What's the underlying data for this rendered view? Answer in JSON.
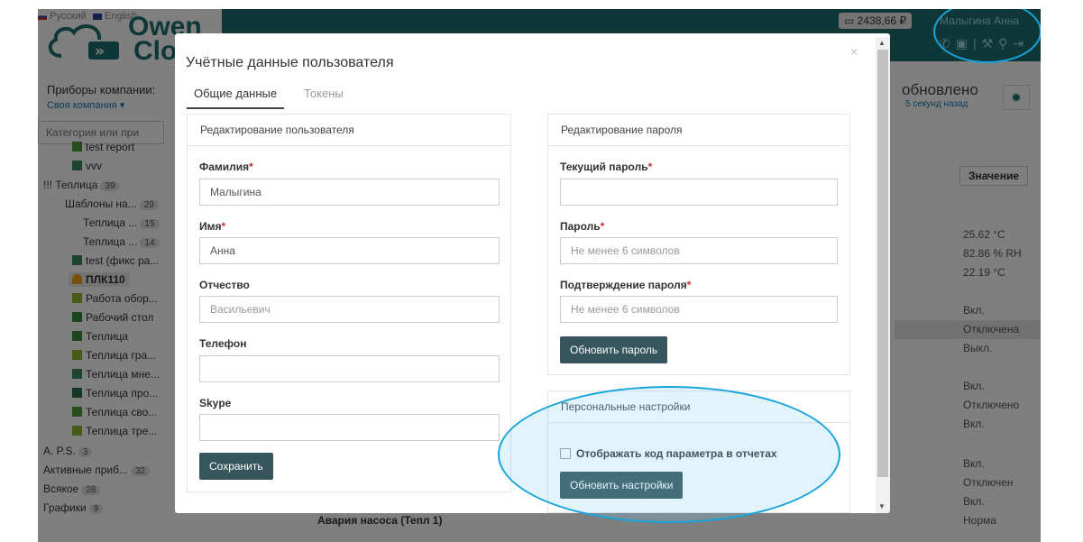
{
  "header": {
    "lang_ru": "Русский",
    "lang_en": "English",
    "logo_line1": "Owen",
    "logo_line2": "Clo",
    "balance": "2438,66 ₽",
    "user_name": "Малыгина Анна",
    "icons": [
      "phone-icon",
      "briefcase-icon",
      "wrench-icon",
      "user-icon",
      "logout-icon"
    ]
  },
  "left": {
    "title": "Приборы компании:",
    "company": "Своя компания ▾",
    "category_placeholder": "Категория или при",
    "tree": [
      {
        "label": "test report",
        "icon": "report-icon"
      },
      {
        "label": "vvv",
        "icon": "mnemo-icon"
      },
      {
        "label": "!!! Теплица",
        "badge": "39"
      },
      {
        "label": "Шаблоны на...",
        "badge": "29"
      },
      {
        "label": "Теплица ...",
        "badge": "15"
      },
      {
        "label": "Теплица ...",
        "badge": "14"
      },
      {
        "label": "test (фикс ра...",
        "icon": "mnemo-icon"
      },
      {
        "label": "ПЛК110",
        "icon": "bell-icon"
      },
      {
        "label": "Работа обор...",
        "icon": "chart-icon"
      },
      {
        "label": "Рабочий стол",
        "icon": "desktop-icon"
      },
      {
        "label": "Теплица",
        "icon": "desktop-icon"
      },
      {
        "label": "Теплица гра...",
        "icon": "chart-icon"
      },
      {
        "label": "Теплица мне...",
        "icon": "mnemo-icon"
      },
      {
        "label": "Теплица про...",
        "icon": "program-icon"
      },
      {
        "label": "Теплица сво...",
        "icon": "report-icon"
      },
      {
        "label": "Теплица тре...",
        "icon": "chart-icon"
      },
      {
        "label": "A. P.S.",
        "badge": "3"
      },
      {
        "label": "Активные приб...",
        "badge": "32"
      },
      {
        "label": "Всякое",
        "badge": "28"
      },
      {
        "label": "Графики",
        "badge": "9"
      }
    ]
  },
  "right": {
    "updated": "обновлено",
    "updated_sub": "5 секунд назад",
    "value_header": "Значение",
    "values": [
      "25.62 °C",
      "82.86 % RH",
      "22.19 °C",
      "Вкл.",
      "Отключена",
      "Выкл.",
      "Вкл.",
      "Отключено",
      "Вкл.",
      "Вкл.",
      "Отключен",
      "Вкл.",
      "Норма"
    ],
    "bottom_row": "Авария насоса (Тепл 1)"
  },
  "modal": {
    "title": "Учётные данные пользователя",
    "close": "×",
    "tabs": [
      "Общие данные",
      "Токены"
    ],
    "user_panel": {
      "head": "Редактирование пользователя",
      "fields": [
        {
          "label": "Фамилия",
          "required": "*",
          "value": "Малыгина",
          "placeholder": ""
        },
        {
          "label": "Имя",
          "required": "*",
          "value": "Анна",
          "placeholder": ""
        },
        {
          "label": "Отчество",
          "required": "",
          "value": "",
          "placeholder": "Васильевич"
        },
        {
          "label": "Телефон",
          "required": "",
          "value": "",
          "placeholder": ""
        },
        {
          "label": "Skype",
          "required": "",
          "value": "",
          "placeholder": ""
        }
      ],
      "save": "Сохранить"
    },
    "password_panel": {
      "head": "Редактирование пароля",
      "fields": [
        {
          "label": "Текущий пароль",
          "required": "*",
          "value": "",
          "placeholder": ""
        },
        {
          "label": "Пароль",
          "required": "*",
          "value": "",
          "placeholder": "Не менее 6 символов"
        },
        {
          "label": "Подтверждение пароля",
          "required": "*",
          "value": "",
          "placeholder": "Не менее 6 символов"
        }
      ],
      "update": "Обновить пароль"
    },
    "personal_panel": {
      "head": "Персональные настройки",
      "checkbox": "Отображать код параметра в отчетах",
      "update": "Обновить настройки"
    }
  },
  "colors": {
    "brand": "#1f6f6e",
    "button": "#37555d",
    "highlight": "#17a4dc",
    "required": "#c9302c"
  }
}
